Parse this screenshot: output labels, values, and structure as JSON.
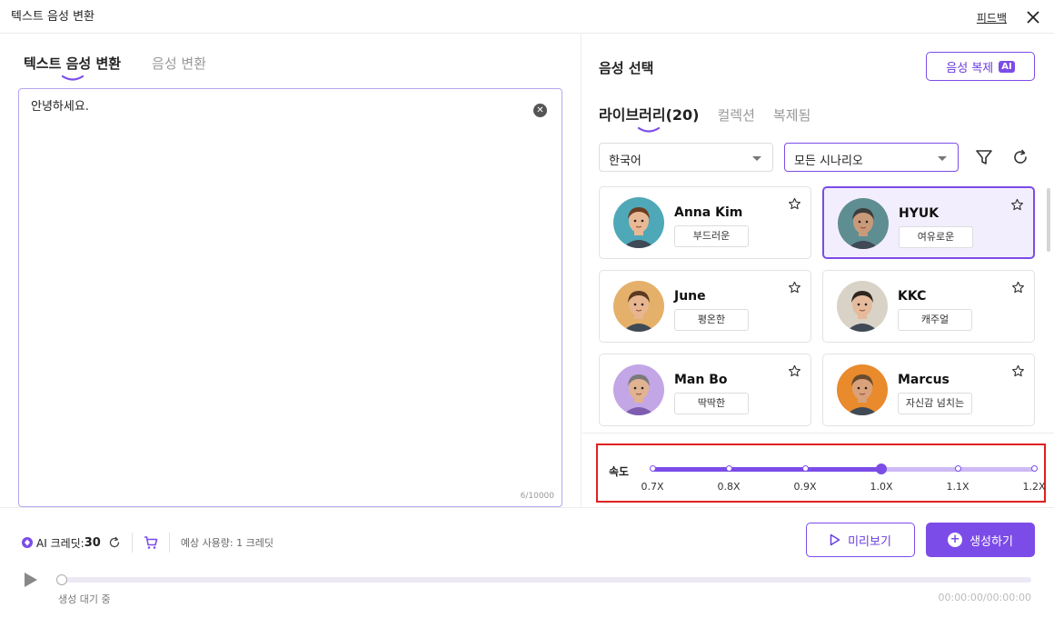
{
  "window": {
    "title": "텍스트 음성 변환",
    "feedback": "피드백"
  },
  "left_tabs": [
    {
      "label": "텍스트 음성 변환",
      "active": true
    },
    {
      "label": "음성 변환",
      "active": false
    }
  ],
  "editor": {
    "text": "안녕하세요.",
    "char_count": "6/10000"
  },
  "voice_panel": {
    "title": "음성 선택",
    "clone_button": "음성 복제",
    "ai_badge": "AI",
    "tabs": [
      {
        "label": "라이브러리(20)",
        "active": true
      },
      {
        "label": "컬렉션",
        "active": false
      },
      {
        "label": "복제됨",
        "active": false
      }
    ],
    "language_select": "한국어",
    "scenario_select": "모든 시나리오"
  },
  "voices": [
    {
      "name": "Anna Kim",
      "tag": "부드러운",
      "selected": false,
      "avatar_bg": "#4fa8b8",
      "skin": "#e9b894",
      "hair": "#6b3e22"
    },
    {
      "name": "HYUK",
      "tag": "여유로운",
      "selected": true,
      "avatar_bg": "#5e8d92",
      "skin": "#c99a7a",
      "hair": "#3d3d3d"
    },
    {
      "name": "June",
      "tag": "평온한",
      "selected": false,
      "avatar_bg": "#e4b06a",
      "skin": "#e7b58f",
      "hair": "#5a3a22"
    },
    {
      "name": "KKC",
      "tag": "캐주얼",
      "selected": false,
      "avatar_bg": "#d9d2c7",
      "skin": "#e5bb9b",
      "hair": "#2e2520"
    },
    {
      "name": "Man Bo",
      "tag": "딱딱한",
      "selected": false,
      "avatar_bg": "#c3a6e6",
      "skin": "#e0b391",
      "hair": "#7a7a7a"
    },
    {
      "name": "Marcus",
      "tag": "자신감 넘치는",
      "selected": false,
      "avatar_bg": "#e98a2c",
      "skin": "#d9a27a",
      "hair": "#6a4a2e"
    }
  ],
  "speed": {
    "label": "속도",
    "ticks": [
      "0.7X",
      "0.8X",
      "0.9X",
      "1.0X",
      "1.1X",
      "1.2X"
    ],
    "value": "1.0X",
    "value_fraction": 0.6
  },
  "footer": {
    "credits_label": "AI 크레딧:",
    "credits_value": "30",
    "usage": "예상 사용량: 1 크레딧",
    "preview_button": "미리보기",
    "generate_button": "생성하기",
    "status": "생성 대기 중",
    "time": "00:00:00/00:00:00",
    "progress_fraction": 0
  },
  "colors": {
    "accent": "#7c4ce8",
    "highlight_border": "#e02020"
  }
}
